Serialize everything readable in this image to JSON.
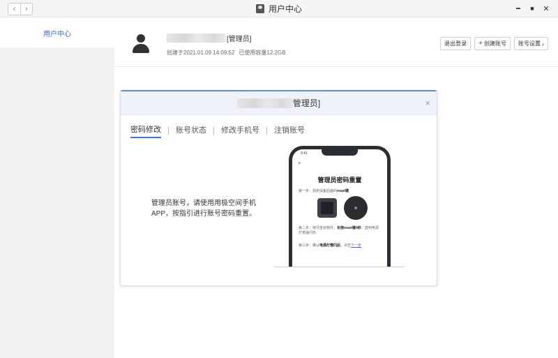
{
  "window": {
    "title": "用户中心",
    "nav_back": "‹",
    "nav_forward": "›",
    "min_glyph": "▬",
    "max_glyph": "■",
    "close_glyph": "✕"
  },
  "sidebar": {
    "items": [
      {
        "label": "用户中心",
        "active": true
      }
    ]
  },
  "header": {
    "role": "[管理员]",
    "created_label": "创建于2021.01.09 14:09:52",
    "storage_label": "已使用容量12.2GB",
    "buttons": {
      "logout": "退出登录",
      "create_account": "创建账号",
      "account_settings": "账号设置"
    }
  },
  "dialog": {
    "title_suffix": "管理员]",
    "close_glyph": "×",
    "tabs": [
      {
        "label": "密码修改",
        "active": true
      },
      {
        "label": "账号状态",
        "active": false
      },
      {
        "label": "修改手机号",
        "active": false
      },
      {
        "label": "注销账号",
        "active": false
      }
    ],
    "description": "管理员账号，请使用用极空间手机APP，按指引进行账号密码重置。",
    "phone": {
      "time": "9:41",
      "close": "×",
      "title": "管理员密码重置",
      "step1_prefix": "第一步：找到设备后面的",
      "step1_bold": "reset键",
      "step2_prefix": "第二步：用牙签状物件，",
      "step2_bold": "长按reset键4秒",
      "step2_suffix": "，直到电源灯慢速闪烁",
      "step3_prefix": "第三步：确认",
      "step3_bold": "电源灯慢闪后",
      "step3_mid": "，点击",
      "step3_link": "下一步"
    }
  },
  "colors": {
    "accent": "#2f6bde",
    "dialog_border_top": "#5b8ee6",
    "dialog_header": "#eef3fb",
    "sidebar_bg": "#f2f2f2"
  },
  "icons": {
    "avatar": "user-silhouette-icon",
    "title": "user-avatar-icon",
    "create": "plus-icon",
    "settings": "chevron-right-icon"
  }
}
